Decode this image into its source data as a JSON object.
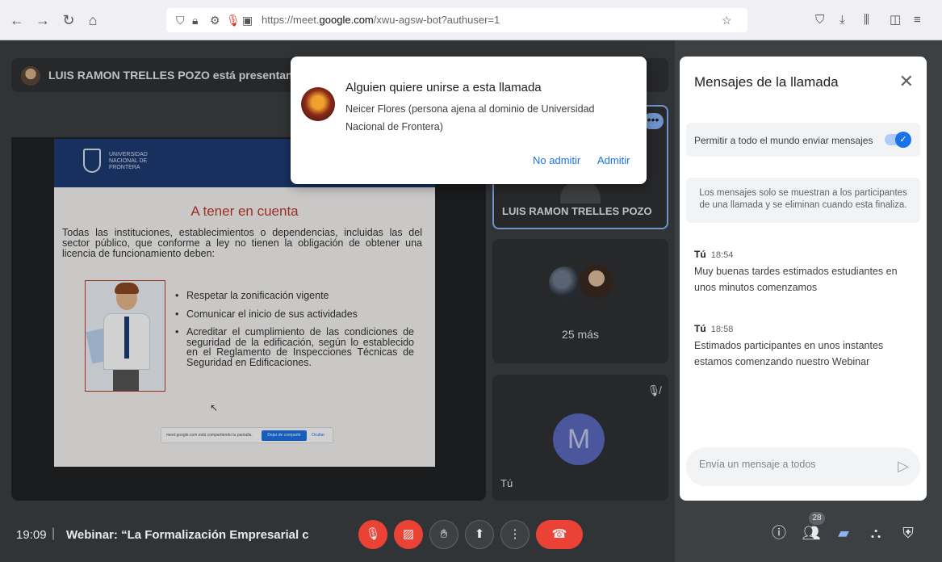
{
  "browser": {
    "url_prefix": "https://meet.",
    "url_domain": "google.com",
    "url_path": "/xwu-agsw-bot?authuser=1"
  },
  "presenter_bar": {
    "text": "LUIS RAMON TRELLES POZO está presentando"
  },
  "slide": {
    "uni_name": "UNIVERSIDAD NACIONAL DE FRONTERA",
    "title": "A tener en cuenta",
    "intro": "Todas las instituciones, establecimientos o dependencias, incluidas las del sector público, que conforme a ley no tienen la obligación de obtener una licencia de funcionamiento deben:",
    "bullets": [
      "Respetar la zonificación vigente",
      "Comunicar el inicio de sus actividades",
      "Acreditar el cumplimiento de las condiciones de seguridad de la edificación, según lo establecido en el Reglamento de Inspecciones Técnicas de Seguridad en Edificaciones."
    ],
    "share_text": "meet.google.com está compartiendo tu pantalla.",
    "share_stop": "Dejar de compartir",
    "share_hide": "Ocultar"
  },
  "tiles": {
    "presenter_name": "LUIS RAMON TRELLES POZO",
    "more_label": "25 más",
    "self_initial": "M",
    "self_name": "Tú"
  },
  "dialog": {
    "title": "Alguien quiere unirse a esta llamada",
    "body": "Neicer Flores (persona ajena al dominio de Universidad Nacional de Frontera)",
    "deny": "No admitir",
    "admit": "Admitir"
  },
  "chat": {
    "title": "Mensajes de la llamada",
    "toggle_label": "Permitir a todo el mundo enviar mensajes",
    "toggle_on": true,
    "notice": "Los mensajes solo se muestran a los participantes de una llamada y se eliminan cuando esta finaliza.",
    "messages": [
      {
        "sender": "Tú",
        "time": "18:54",
        "text": "Muy buenas tardes estimados estudiantes en unos minutos comenzamos"
      },
      {
        "sender": "Tú",
        "time": "18:58",
        "text": "Estimados participantes en unos instantes estamos comenzando nuestro Webinar"
      }
    ],
    "input_placeholder": "Envía un mensaje a todos"
  },
  "bottom": {
    "time": "19:09",
    "separator": "|",
    "meeting_title": "Webinar: “La Formalización Empresarial contr...",
    "participants_count": "28"
  },
  "colors": {
    "accent": "#1a73e8",
    "danger": "#ea4335",
    "slide_header": "#1d3b73",
    "slide_title": "#c0392b"
  }
}
